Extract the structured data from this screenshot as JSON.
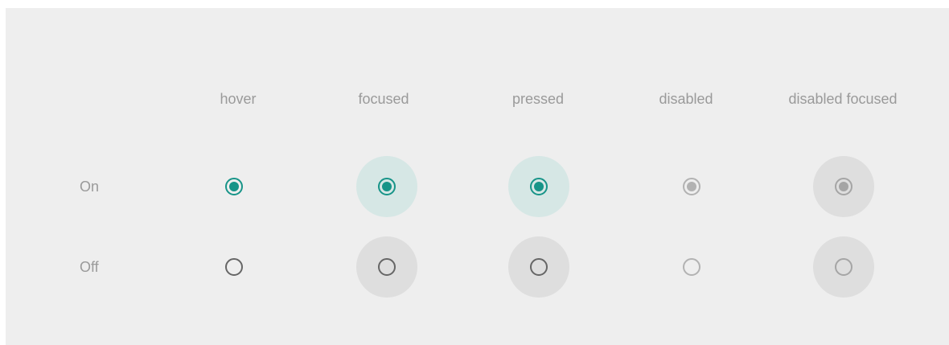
{
  "columns": [
    "hover",
    "focused",
    "pressed",
    "disabled",
    "disabled focused"
  ],
  "rows": [
    "On",
    "Off"
  ],
  "states": {
    "on": {
      "hover": true,
      "focused": true,
      "pressed": true,
      "disabled": true,
      "disabled_focused": true
    },
    "off": {
      "hover": false,
      "focused": false,
      "pressed": false,
      "disabled": false,
      "disabled_focused": false
    }
  },
  "colors": {
    "accent": "#179488",
    "focus_halo_on": "#d6e7e5",
    "focus_halo_off": "#dedede",
    "unchecked_border": "#666666",
    "disabled": "#b2b2b2",
    "panel_background": "#eeeeee",
    "label_text": "#9a9a9a"
  }
}
